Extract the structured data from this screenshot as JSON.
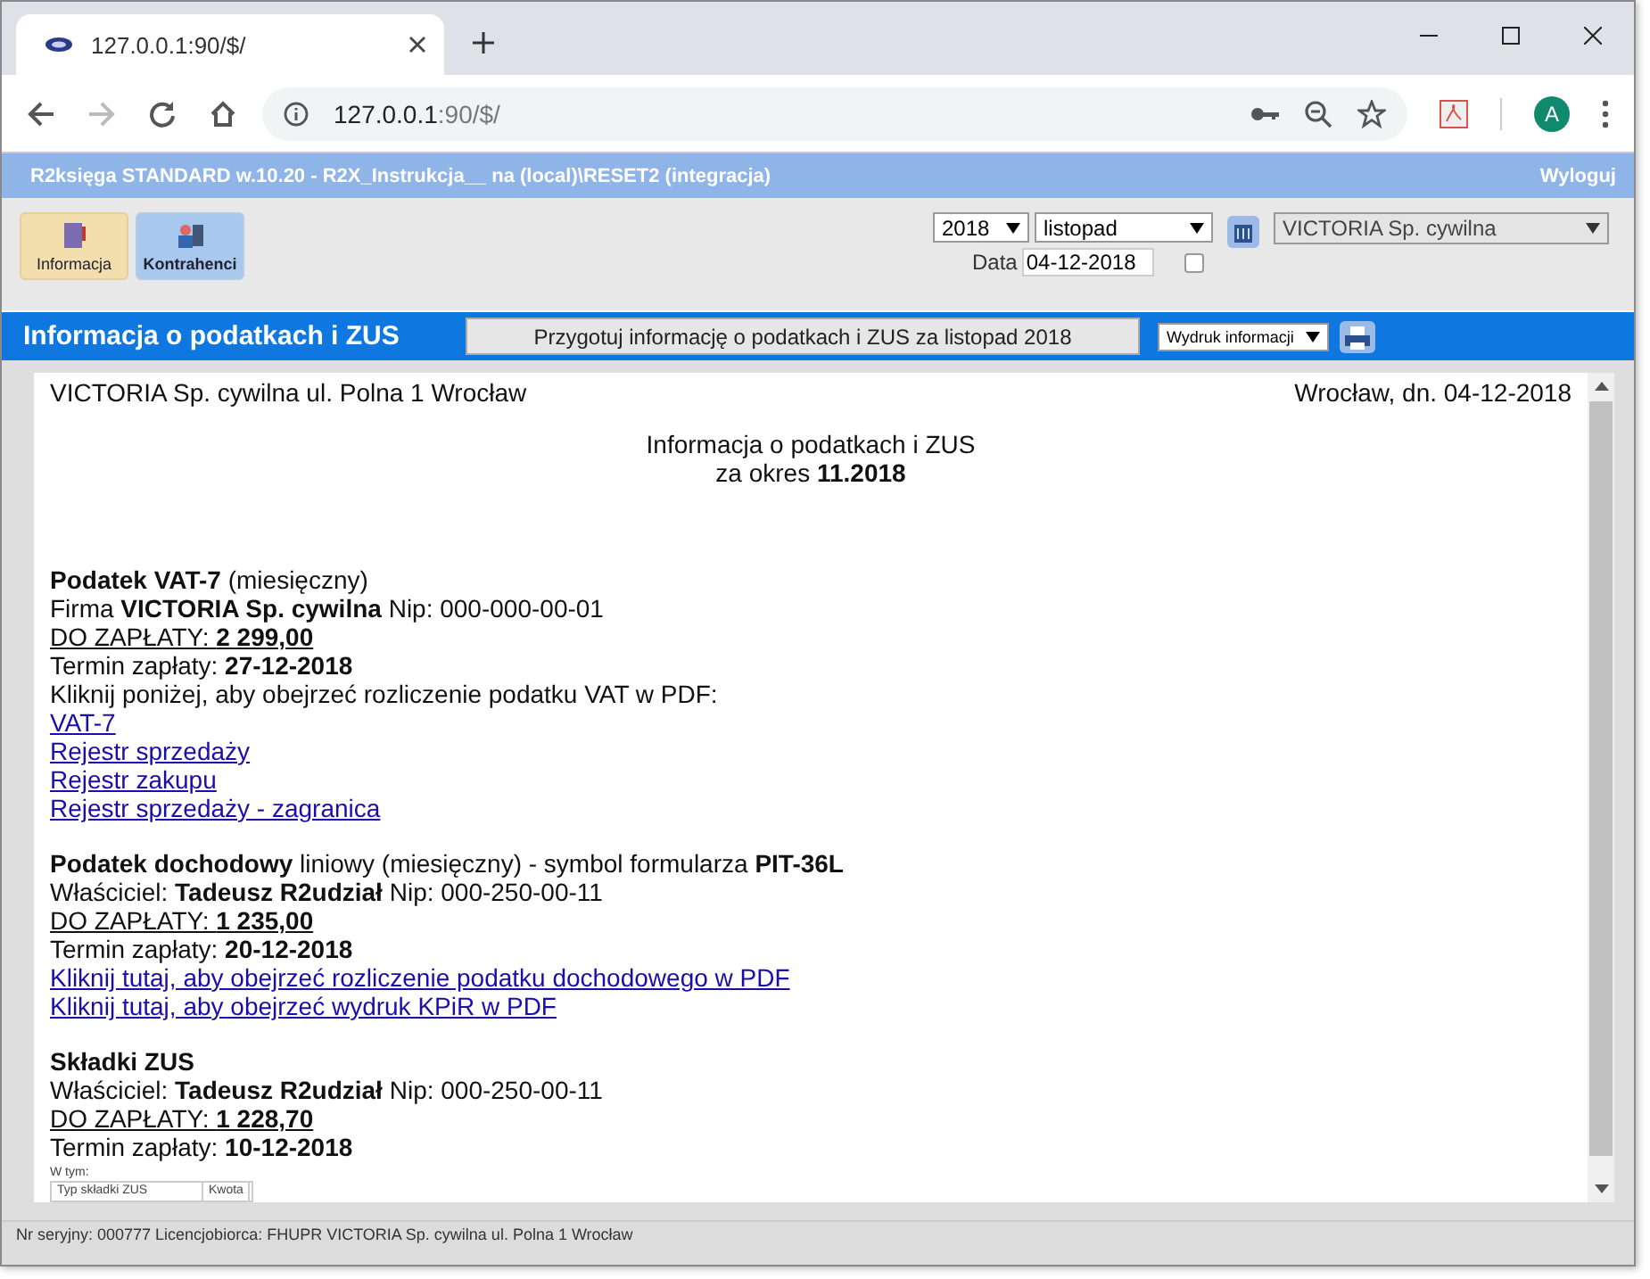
{
  "browser": {
    "tab_title": "127.0.0.1:90/$/",
    "url_host": "127.0.0.1",
    "url_rest": ":90/$/",
    "avatar": "A"
  },
  "app": {
    "title": "R2księga STANDARD w.10.20 - R2X_Instrukcja__ na (local)\\RESET2 (integracja)",
    "logout": "Wyloguj",
    "toolbar": [
      {
        "label": "Informacja",
        "selected": true
      },
      {
        "label": "Kontrahenci",
        "selected": false
      }
    ],
    "year": "2018",
    "month": "listopad",
    "date_label": "Data",
    "date": "04-12-2018",
    "date_checked": false,
    "company": "VICTORIA Sp. cywilna",
    "section_title": "Informacja o podatkach i ZUS",
    "prepare_button": "Przygotuj informację o podatkach i ZUS za listopad 2018",
    "print_select": "Wydruk informacji"
  },
  "document": {
    "header_left": "VICTORIA Sp. cywilna ul. Polna 1 Wrocław",
    "header_right": "Wrocław, dn. 04-12-2018",
    "title": "Informacja o podatkach i ZUS",
    "period": "za okres **11.2018**",
    "sections": [
      {
        "lines": [
          {
            "kind": "text",
            "text": "**Podatek VAT-7** (miesięczny)"
          },
          {
            "kind": "text",
            "text": "Firma **VICTORIA Sp. cywilna** Nip: 000-000-00-01"
          },
          {
            "kind": "due",
            "text": "DO ZAPŁATY: **2 299,00**"
          },
          {
            "kind": "text",
            "text": "Termin zapłaty: **27-12-2018**"
          },
          {
            "kind": "text",
            "text": "Kliknij poniżej, aby obejrzeć rozliczenie podatku VAT w PDF:"
          },
          {
            "kind": "link",
            "text": "VAT-7"
          },
          {
            "kind": "link",
            "text": "Rejestr sprzedaży"
          },
          {
            "kind": "link",
            "text": "Rejestr zakupu"
          },
          {
            "kind": "link",
            "text": "Rejestr sprzedaży - zagranica"
          }
        ]
      },
      {
        "lines": [
          {
            "kind": "text",
            "text": "**Podatek dochodowy** liniowy (miesięczny) - symbol formularza **PIT-36L**"
          },
          {
            "kind": "text",
            "text": "Właściciel: **Tadeusz R2udział** Nip: 000-250-00-11"
          },
          {
            "kind": "due",
            "text": "DO ZAPŁATY: **1 235,00**"
          },
          {
            "kind": "text",
            "text": "Termin zapłaty: **20-12-2018**"
          },
          {
            "kind": "link",
            "text": "Kliknij tutaj, aby obejrzeć rozliczenie podatku dochodowego w PDF"
          },
          {
            "kind": "link",
            "text": "Kliknij tutaj, aby obejrzeć wydruk KPiR w PDF"
          }
        ]
      },
      {
        "lines": [
          {
            "kind": "text",
            "text": "**Składki ZUS**"
          },
          {
            "kind": "text",
            "text": "Właściciel: **Tadeusz R2udział** Nip: 000-250-00-11"
          },
          {
            "kind": "due",
            "text": "DO ZAPŁATY: **1 228,70**"
          },
          {
            "kind": "text",
            "text": "Termin zapłaty: **10-12-2018**"
          }
        ]
      }
    ],
    "table_caption": "W tym:",
    "table_columns": [
      "Typ składki ZUS",
      "Kwota"
    ]
  },
  "status_bar": "Nr seryjny: 000777 Licencjobiorca: FHUPR VICTORIA Sp. cywilna ul. Polna 1 Wrocław"
}
